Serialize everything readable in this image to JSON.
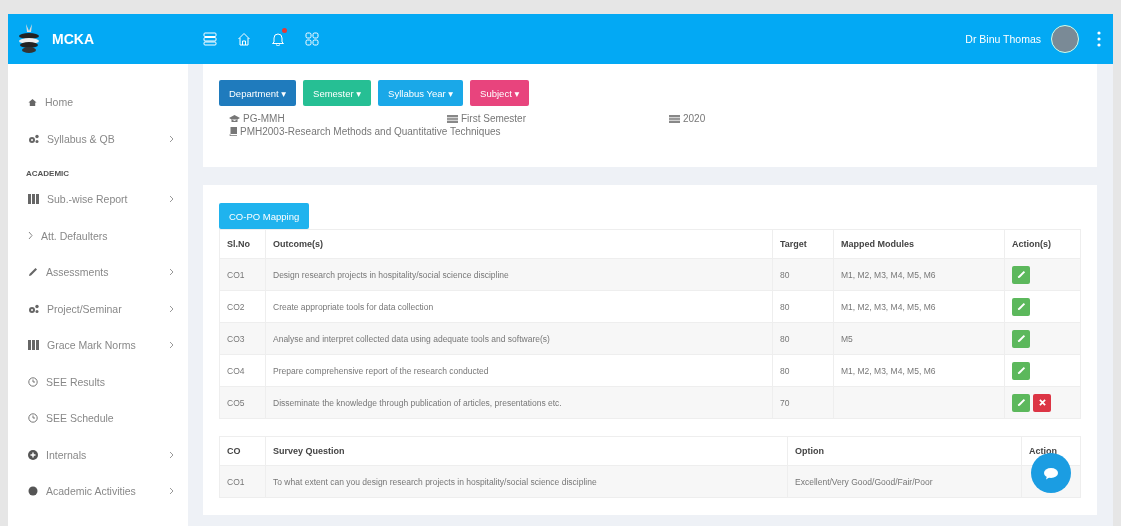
{
  "topbar": {
    "brand": "MCKA",
    "notification_dot": true,
    "user_name": "Dr Binu Thomas"
  },
  "sidebar": {
    "items": [
      {
        "kind": "home",
        "label": "Home",
        "chevron": false
      },
      {
        "kind": "gears",
        "label": "Syllabus & QB",
        "chevron": true
      },
      {
        "kind": "section",
        "label": "ACADEMIC"
      },
      {
        "kind": "columns",
        "label": "Sub.-wise Report",
        "chevron": true
      },
      {
        "kind": "angle",
        "label": "Att. Defaulters",
        "chevron": false
      },
      {
        "kind": "pencil",
        "label": "Assessments",
        "chevron": true
      },
      {
        "kind": "gears",
        "label": "Project/Seminar",
        "chevron": true
      },
      {
        "kind": "columns",
        "label": "Grace Mark Norms",
        "chevron": true
      },
      {
        "kind": "clock",
        "label": "SEE Results",
        "chevron": false
      },
      {
        "kind": "clock",
        "label": "SEE Schedule",
        "chevron": false
      },
      {
        "kind": "plus",
        "label": "Internals",
        "chevron": true
      },
      {
        "kind": "dot",
        "label": "Academic Activities",
        "chevron": true
      }
    ]
  },
  "filters": [
    {
      "label": "Department ▾",
      "color": "#1f7bbd"
    },
    {
      "label": "Semester ▾",
      "color": "#26bf94"
    },
    {
      "label": "Syllabus Year ▾",
      "color": "#1aa8e8"
    },
    {
      "label": "Subject ▾",
      "color": "#e8447d"
    }
  ],
  "selection": {
    "department": "PG-MMH",
    "semester": "First Semester",
    "year": "2020",
    "subject": "PMH2003-Research Methods and Quantitative Techniques"
  },
  "mapping_button": "CO-PO Mapping",
  "outcomes_table": {
    "columns": [
      "Sl.No",
      "Outcome(s)",
      "Target",
      "Mapped Modules",
      "Action(s)"
    ],
    "rows": [
      {
        "sl": "CO1",
        "outcome": "Design research projects in hospitality/social science discipline",
        "target": "80",
        "modules": "M1, M2, M3, M4, M5, M6",
        "actions": [
          {
            "kind": "edit"
          }
        ]
      },
      {
        "sl": "CO2",
        "outcome": "Create appropriate tools for data collection",
        "target": "80",
        "modules": "M1, M2, M3, M4, M5, M6",
        "actions": [
          {
            "kind": "edit"
          }
        ]
      },
      {
        "sl": "CO3",
        "outcome": "Analyse and interpret collected data using adequate tools and software(s)",
        "target": "80",
        "modules": "M5",
        "actions": [
          {
            "kind": "edit"
          }
        ]
      },
      {
        "sl": "CO4",
        "outcome": "Prepare comprehensive report of the research conducted",
        "target": "80",
        "modules": "M1, M2, M3, M4, M5, M6",
        "actions": [
          {
            "kind": "edit"
          }
        ]
      },
      {
        "sl": "CO5",
        "outcome": "Disseminate the knowledge through publication of articles, presentations etc.",
        "target": "70",
        "actions": [
          {
            "kind": "edit"
          },
          {
            "kind": "delete"
          }
        ]
      }
    ]
  },
  "survey_table": {
    "columns": [
      "CO",
      "Survey Question",
      "Option",
      "Action"
    ],
    "rows": [
      {
        "co": "CO1",
        "question": "To what extent can you design research projects in hospitality/social science discipline",
        "option": "Excellent/Very Good/Good/Fair/Poor"
      }
    ]
  }
}
